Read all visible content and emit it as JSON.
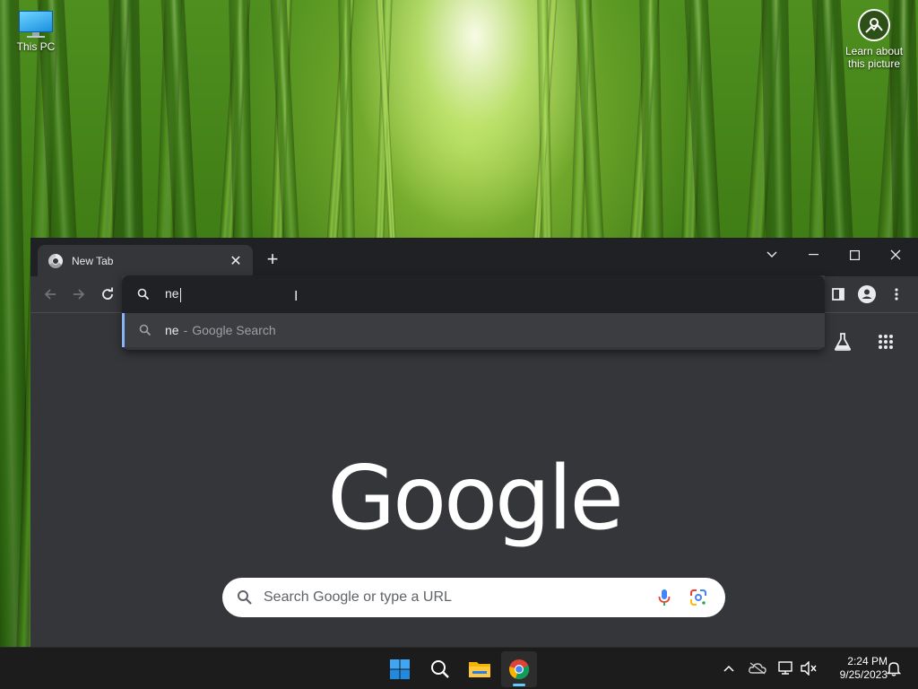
{
  "desktop": {
    "icons": [
      {
        "label": "This PC"
      }
    ],
    "spotlight": {
      "label_line1": "Learn about",
      "label_line2": "this picture"
    }
  },
  "browser": {
    "tab": {
      "title": "New Tab"
    },
    "omnibox": {
      "typed_text": "ne",
      "suggestion": {
        "query": "ne",
        "separator": "-",
        "engine_text": "Google Search"
      }
    },
    "ntp": {
      "logo_text": "Google",
      "search_placeholder": "Search Google or type a URL"
    }
  },
  "taskbar": {
    "apps": [
      "start-icon",
      "search-icon",
      "file-explorer-icon",
      "chrome-icon"
    ],
    "clock": {
      "time": "2:24 PM",
      "date": "9/25/2023"
    }
  },
  "colors": {
    "accent": "#8ab4f8",
    "browser_bg": "#35363a",
    "titlebar_bg": "#202124",
    "taskbar_bg": "#1c1c1c"
  }
}
